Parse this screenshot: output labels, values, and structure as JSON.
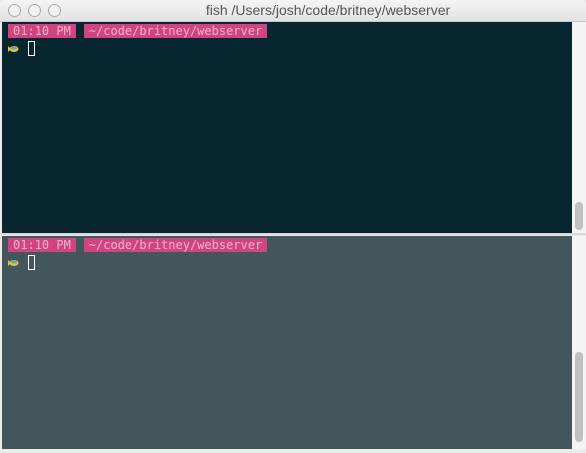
{
  "window": {
    "title": "fish  /Users/josh/code/britney/webserver"
  },
  "panes": [
    {
      "time": "01:10 PM",
      "path": "~/code/britney/webserver",
      "bg": "#08262f"
    },
    {
      "time": "01:10 PM",
      "path": "~/code/britney/webserver",
      "bg": "#43565b"
    }
  ],
  "colors": {
    "badge": "#d0457f",
    "badge_text": "#f0b4cf"
  }
}
